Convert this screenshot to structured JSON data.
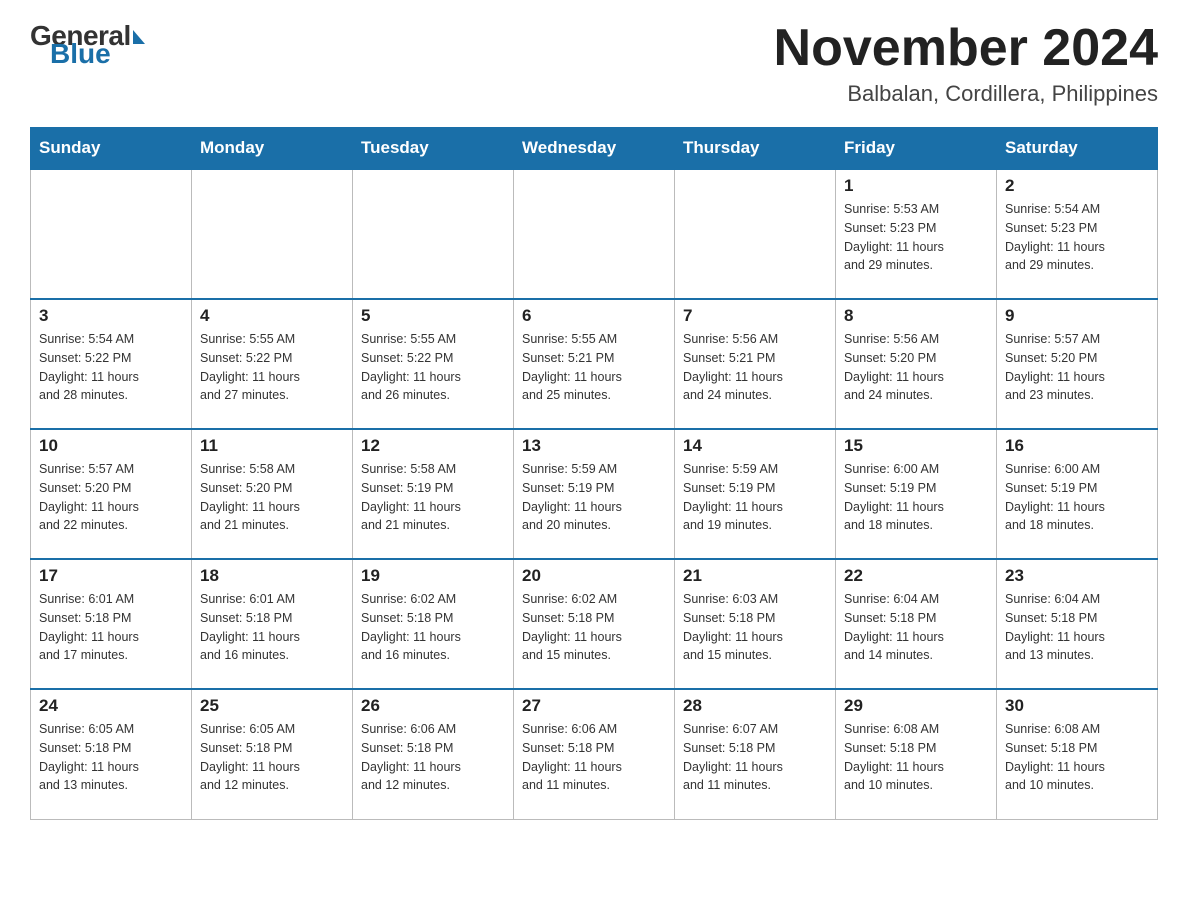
{
  "logo": {
    "general": "General",
    "blue": "Blue"
  },
  "title": {
    "month": "November 2024",
    "location": "Balbalan, Cordillera, Philippines"
  },
  "weekdays": [
    "Sunday",
    "Monday",
    "Tuesday",
    "Wednesday",
    "Thursday",
    "Friday",
    "Saturday"
  ],
  "weeks": [
    [
      {
        "day": "",
        "info": ""
      },
      {
        "day": "",
        "info": ""
      },
      {
        "day": "",
        "info": ""
      },
      {
        "day": "",
        "info": ""
      },
      {
        "day": "",
        "info": ""
      },
      {
        "day": "1",
        "info": "Sunrise: 5:53 AM\nSunset: 5:23 PM\nDaylight: 11 hours\nand 29 minutes."
      },
      {
        "day": "2",
        "info": "Sunrise: 5:54 AM\nSunset: 5:23 PM\nDaylight: 11 hours\nand 29 minutes."
      }
    ],
    [
      {
        "day": "3",
        "info": "Sunrise: 5:54 AM\nSunset: 5:22 PM\nDaylight: 11 hours\nand 28 minutes."
      },
      {
        "day": "4",
        "info": "Sunrise: 5:55 AM\nSunset: 5:22 PM\nDaylight: 11 hours\nand 27 minutes."
      },
      {
        "day": "5",
        "info": "Sunrise: 5:55 AM\nSunset: 5:22 PM\nDaylight: 11 hours\nand 26 minutes."
      },
      {
        "day": "6",
        "info": "Sunrise: 5:55 AM\nSunset: 5:21 PM\nDaylight: 11 hours\nand 25 minutes."
      },
      {
        "day": "7",
        "info": "Sunrise: 5:56 AM\nSunset: 5:21 PM\nDaylight: 11 hours\nand 24 minutes."
      },
      {
        "day": "8",
        "info": "Sunrise: 5:56 AM\nSunset: 5:20 PM\nDaylight: 11 hours\nand 24 minutes."
      },
      {
        "day": "9",
        "info": "Sunrise: 5:57 AM\nSunset: 5:20 PM\nDaylight: 11 hours\nand 23 minutes."
      }
    ],
    [
      {
        "day": "10",
        "info": "Sunrise: 5:57 AM\nSunset: 5:20 PM\nDaylight: 11 hours\nand 22 minutes."
      },
      {
        "day": "11",
        "info": "Sunrise: 5:58 AM\nSunset: 5:20 PM\nDaylight: 11 hours\nand 21 minutes."
      },
      {
        "day": "12",
        "info": "Sunrise: 5:58 AM\nSunset: 5:19 PM\nDaylight: 11 hours\nand 21 minutes."
      },
      {
        "day": "13",
        "info": "Sunrise: 5:59 AM\nSunset: 5:19 PM\nDaylight: 11 hours\nand 20 minutes."
      },
      {
        "day": "14",
        "info": "Sunrise: 5:59 AM\nSunset: 5:19 PM\nDaylight: 11 hours\nand 19 minutes."
      },
      {
        "day": "15",
        "info": "Sunrise: 6:00 AM\nSunset: 5:19 PM\nDaylight: 11 hours\nand 18 minutes."
      },
      {
        "day": "16",
        "info": "Sunrise: 6:00 AM\nSunset: 5:19 PM\nDaylight: 11 hours\nand 18 minutes."
      }
    ],
    [
      {
        "day": "17",
        "info": "Sunrise: 6:01 AM\nSunset: 5:18 PM\nDaylight: 11 hours\nand 17 minutes."
      },
      {
        "day": "18",
        "info": "Sunrise: 6:01 AM\nSunset: 5:18 PM\nDaylight: 11 hours\nand 16 minutes."
      },
      {
        "day": "19",
        "info": "Sunrise: 6:02 AM\nSunset: 5:18 PM\nDaylight: 11 hours\nand 16 minutes."
      },
      {
        "day": "20",
        "info": "Sunrise: 6:02 AM\nSunset: 5:18 PM\nDaylight: 11 hours\nand 15 minutes."
      },
      {
        "day": "21",
        "info": "Sunrise: 6:03 AM\nSunset: 5:18 PM\nDaylight: 11 hours\nand 15 minutes."
      },
      {
        "day": "22",
        "info": "Sunrise: 6:04 AM\nSunset: 5:18 PM\nDaylight: 11 hours\nand 14 minutes."
      },
      {
        "day": "23",
        "info": "Sunrise: 6:04 AM\nSunset: 5:18 PM\nDaylight: 11 hours\nand 13 minutes."
      }
    ],
    [
      {
        "day": "24",
        "info": "Sunrise: 6:05 AM\nSunset: 5:18 PM\nDaylight: 11 hours\nand 13 minutes."
      },
      {
        "day": "25",
        "info": "Sunrise: 6:05 AM\nSunset: 5:18 PM\nDaylight: 11 hours\nand 12 minutes."
      },
      {
        "day": "26",
        "info": "Sunrise: 6:06 AM\nSunset: 5:18 PM\nDaylight: 11 hours\nand 12 minutes."
      },
      {
        "day": "27",
        "info": "Sunrise: 6:06 AM\nSunset: 5:18 PM\nDaylight: 11 hours\nand 11 minutes."
      },
      {
        "day": "28",
        "info": "Sunrise: 6:07 AM\nSunset: 5:18 PM\nDaylight: 11 hours\nand 11 minutes."
      },
      {
        "day": "29",
        "info": "Sunrise: 6:08 AM\nSunset: 5:18 PM\nDaylight: 11 hours\nand 10 minutes."
      },
      {
        "day": "30",
        "info": "Sunrise: 6:08 AM\nSunset: 5:18 PM\nDaylight: 11 hours\nand 10 minutes."
      }
    ]
  ]
}
